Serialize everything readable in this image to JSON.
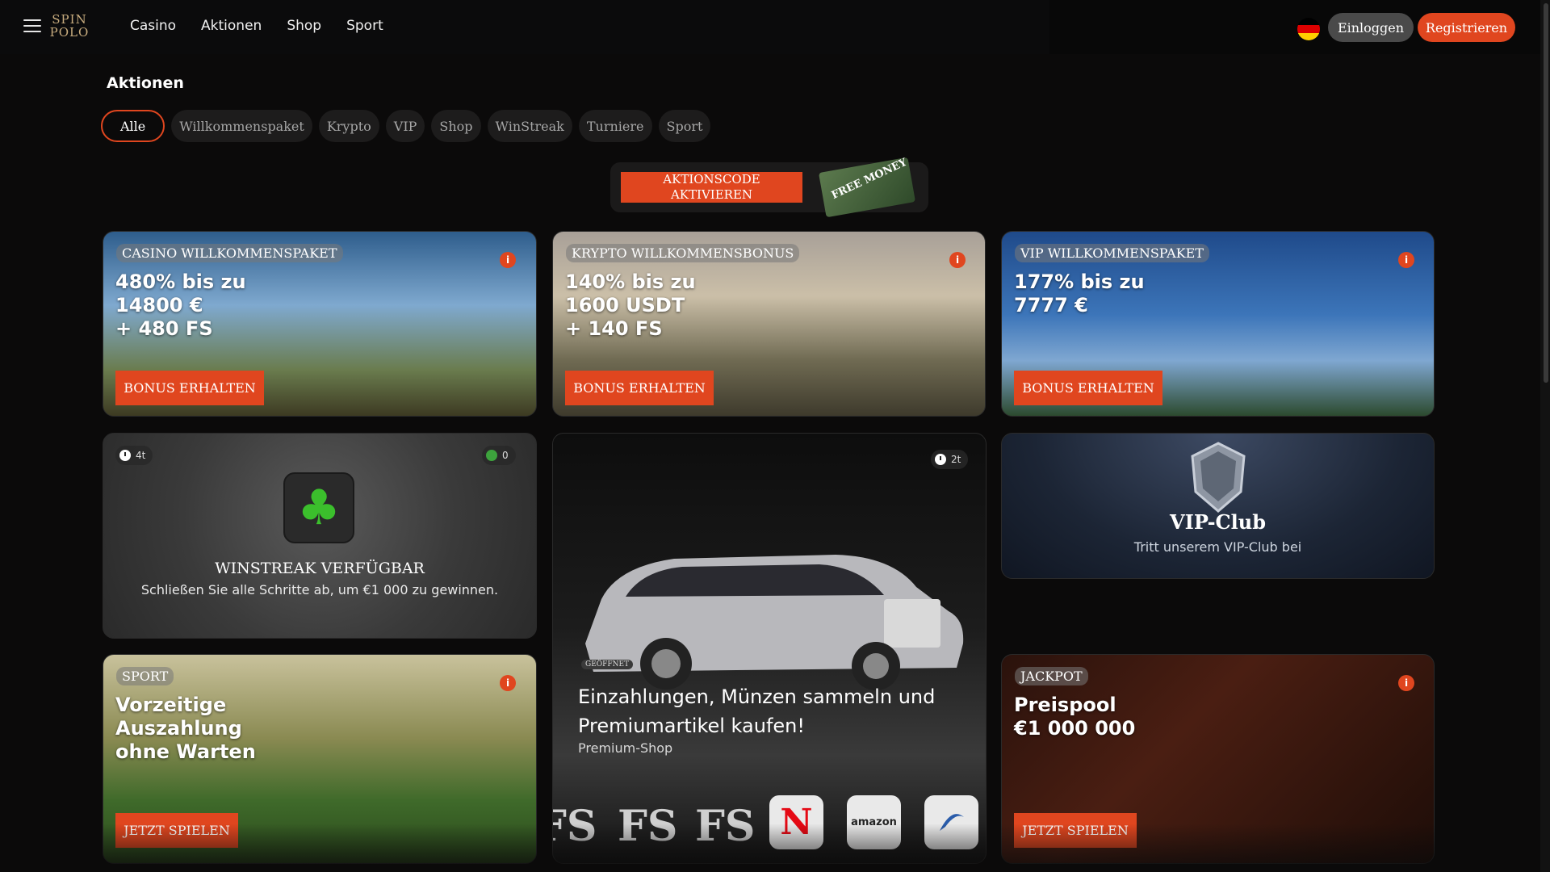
{
  "header": {
    "logo_line1": "SPIN",
    "logo_line2": "POLO",
    "nav": [
      "Casino",
      "Aktionen",
      "Shop",
      "Sport"
    ],
    "login_label": "Einloggen",
    "register_label": "Registrieren",
    "flag_colors": [
      "#000000",
      "#dd0000",
      "#ffce00"
    ]
  },
  "page": {
    "title": "Aktionen",
    "filters": [
      "Alle",
      "Willkommenspaket",
      "Krypto",
      "VIP",
      "Shop",
      "WinStreak",
      "Turniere",
      "Sport"
    ],
    "active_filter": "Alle"
  },
  "promo": {
    "button_label": "AKTIONSCODE AKTIVIEREN",
    "note_text": "FREE MONEY"
  },
  "cards": {
    "casino": {
      "tag": "CASINO WILLKOMMENSPAKET",
      "line1": "480% bis zu",
      "line2": "14800 €",
      "line3": "+ 480 FS",
      "button": "BONUS ERHALTEN"
    },
    "crypto": {
      "tag": "KRYPTO WILLKOMMENSBONUS",
      "line1": "140% bis zu",
      "line2": "1600 USDT",
      "line3": "+ 140 FS",
      "button": "BONUS ERHALTEN"
    },
    "vip_welcome": {
      "tag": "VIP WILLKOMMENSPAKET",
      "line1": "177% bis zu",
      "line2": "7777 €",
      "button": "BONUS ERHALTEN"
    },
    "winstreak": {
      "timer": "4t",
      "count": "0",
      "title": "WINSTREAK VERFÜGBAR",
      "subtitle": "Schließen Sie alle Schritte ab, um €1 000 zu gewinnen."
    },
    "shop": {
      "timer": "2t",
      "badge": "GEÖFFNET",
      "title": "Einzahlungen, Münzen sammeln und Premiumartikel kaufen!",
      "subtitle": "Premium-Shop",
      "icons": [
        "FS",
        "FS",
        "FS",
        "N",
        "amazon",
        "steam"
      ]
    },
    "vip_club": {
      "title": "VIP-Club",
      "subtitle": "Tritt unserem VIP-Club bei"
    },
    "sport": {
      "tag": "SPORT",
      "line1": "Vorzeitige",
      "line2": "Auszahlung",
      "line3": "ohne Warten",
      "button": "JETZT SPIELEN"
    },
    "jackpot": {
      "tag": "JACKPOT",
      "line1": "Preispool",
      "line2": "€1 000 000",
      "button": "JETZT SPIELEN"
    }
  },
  "icons": {
    "menu": "hamburger-icon",
    "info": "info-icon",
    "timer": "clock-icon",
    "clover": "clover-icon",
    "shield": "vip-shield-icon"
  },
  "colors": {
    "accent": "#e0461f",
    "background": "#0b0a0a",
    "chip": "#1d1c1c"
  }
}
